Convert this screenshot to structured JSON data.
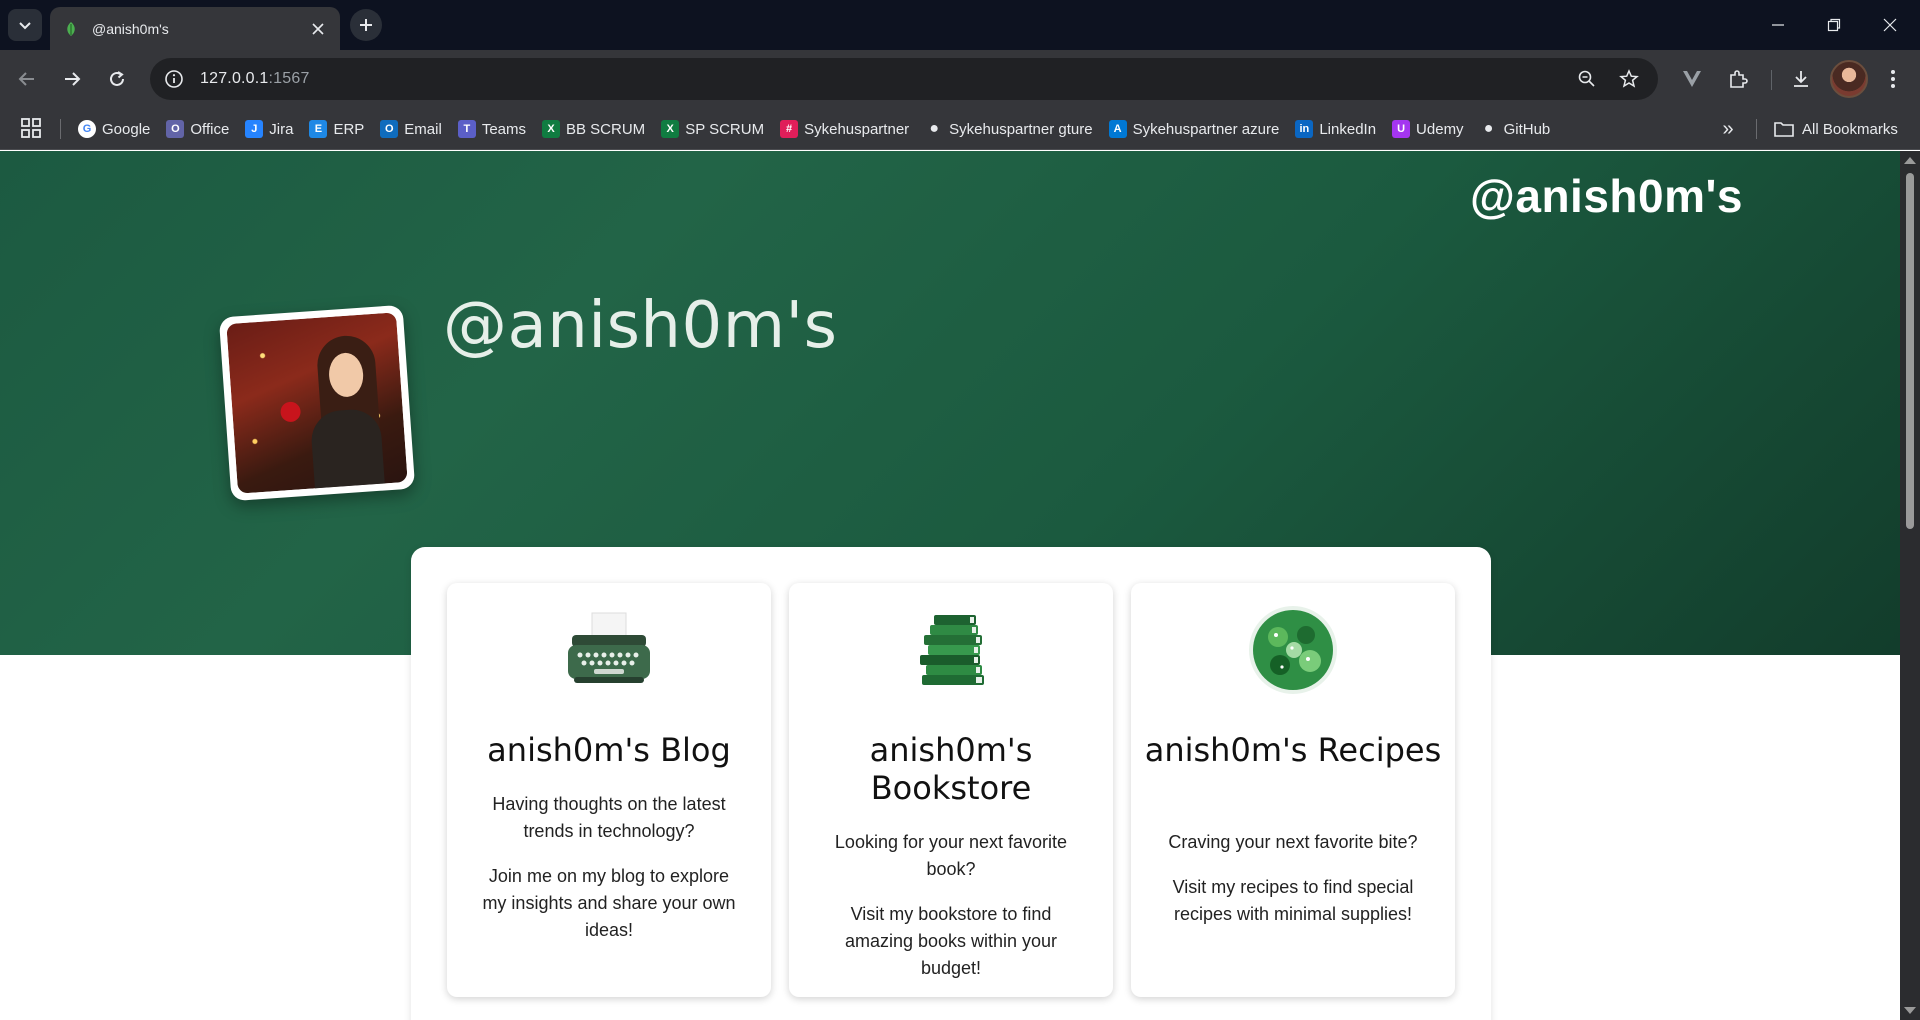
{
  "browser": {
    "tab_title": "@anish0m's",
    "url_host": "127.0.0.1",
    "url_port": ":1567"
  },
  "bookmarks": [
    {
      "label": "Google",
      "icon": "google-icon",
      "color": "#4285f4"
    },
    {
      "label": "Office",
      "icon": "office-icon",
      "color": "#6264a7"
    },
    {
      "label": "Jira",
      "icon": "jira-icon",
      "color": "#2684ff"
    },
    {
      "label": "ERP",
      "icon": "erp-icon",
      "color": "#1e88e5"
    },
    {
      "label": "Email",
      "icon": "outlook-icon",
      "color": "#0f6cbd"
    },
    {
      "label": "Teams",
      "icon": "teams-icon",
      "color": "#5b5fc7"
    },
    {
      "label": "BB SCRUM",
      "icon": "excel-icon",
      "color": "#107c41"
    },
    {
      "label": "SP SCRUM",
      "icon": "excel-icon",
      "color": "#107c41"
    },
    {
      "label": "Sykehuspartner",
      "icon": "slack-icon",
      "color": "#e01e5a"
    },
    {
      "label": "Sykehuspartner gture",
      "icon": "github-icon",
      "color": "#e8eaed"
    },
    {
      "label": "Sykehuspartner azure",
      "icon": "azure-devops-icon",
      "color": "#0078d4"
    },
    {
      "label": "LinkedIn",
      "icon": "linkedin-icon",
      "color": "#0a66c2"
    },
    {
      "label": "Udemy",
      "icon": "udemy-icon",
      "color": "#a435f0"
    },
    {
      "label": "GitHub",
      "icon": "github-icon",
      "color": "#e8eaed"
    }
  ],
  "bookmarks_all_label": "All Bookmarks",
  "page": {
    "brand": "@anish0m's",
    "heading": "@anish0m's",
    "accent_color": "#1f5f43",
    "cards": [
      {
        "title": "anish0m's Blog",
        "icon": "typewriter-icon",
        "paragraphs": [
          "Having thoughts on the latest trends in technology?",
          "Join me on my blog to explore my insights and share your own ideas!"
        ]
      },
      {
        "title": "anish0m's Bookstore",
        "icon": "books-stack-icon",
        "paragraphs": [
          "Looking for your next favorite book?",
          "Visit my bookstore to find amazing books within your budget!"
        ]
      },
      {
        "title": "anish0m's Recipes",
        "icon": "recipes-icon",
        "paragraphs": [
          "Craving your next favorite bite?",
          "Visit my recipes to find special recipes with minimal supplies!"
        ]
      }
    ]
  }
}
